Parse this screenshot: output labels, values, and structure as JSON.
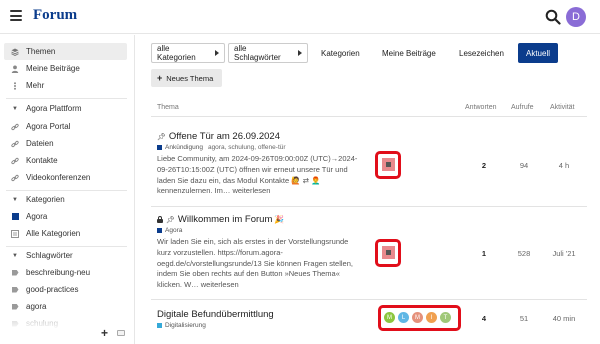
{
  "header": {
    "title": "Forum",
    "avatar_letter": "D",
    "accent": "#0b3c8c"
  },
  "sidebar": {
    "nav": [
      {
        "label": "Themen",
        "icon": "layers-icon",
        "active": true
      },
      {
        "label": "Meine Beiträge",
        "icon": "user-icon"
      },
      {
        "label": "Mehr",
        "icon": "more-dots-icon"
      }
    ],
    "sections": {
      "agora": {
        "label": "Agora Plattform",
        "items": [
          "Agora Portal",
          "Dateien",
          "Kontakte",
          "Videokonferenzen"
        ]
      },
      "kategorien": {
        "label": "Kategorien",
        "items": [
          "Agora",
          "Alle Kategorien"
        ]
      },
      "schlagwoerter": {
        "label": "Schlagwörter",
        "items": [
          "beschreibung-neu",
          "good-practices",
          "agora",
          "schulung"
        ]
      }
    }
  },
  "controls": {
    "all_categories": "alle Kategorien",
    "all_tags": "alle Schlagwörter",
    "nav": [
      "Kategorien",
      "Meine Beiträge",
      "Lesezeichen",
      "Aktuell"
    ],
    "new_topic": "Neues Thema"
  },
  "table": {
    "headers": {
      "topic": "Thema",
      "replies": "Antworten",
      "views": "Aufrufe",
      "activity": "Aktivität"
    },
    "topics": [
      {
        "title": "Offene Tür am 26.09.2024",
        "category": "Ankündigung",
        "category_color": "#0b3c8c",
        "tags": "agora, schulung, offene-tür",
        "excerpt_1": "Liebe Community, am 2024-09-26T09:00:00Z (UTC)→2024-",
        "excerpt_2": "09-26T10:15:00Z (UTC) öffnen wir erneut unsere Tür und",
        "excerpt_3": "laden Sie dazu ein, das Modul Kontakte 🙋 ⇄ 👨‍🦰",
        "excerpt_4": "kennenzulernen. Im… weiterlesen",
        "replies": "2",
        "views": "94",
        "activity": "4 h"
      },
      {
        "title": "Willkommen im Forum",
        "category": "Agora",
        "category_color": "#0b3c8c",
        "excerpt_1": "Wir laden Sie ein, sich als erstes in der Vorstellungsrunde",
        "excerpt_2": "kurz vorzustellen. https://forum.agora-",
        "excerpt_3": "oegd.de/c/vorstellungsrunde/13 Sie können Fragen stellen,",
        "excerpt_4": "indem Sie oben rechts auf den Button »Neues Thema«",
        "excerpt_5": "klicken. W… weiterlesen",
        "replies": "1",
        "views": "528",
        "activity": "Juli '21"
      },
      {
        "title": "Digitale Befundübermittlung",
        "category": "Digitalisierung",
        "category_color": "#35a9d8",
        "participants": [
          "M",
          "L",
          "M",
          "I",
          "T"
        ],
        "replies": "4",
        "views": "51",
        "activity": "40 min"
      }
    ]
  }
}
